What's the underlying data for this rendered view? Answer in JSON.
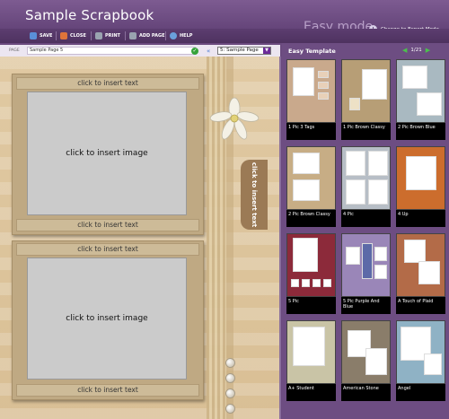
{
  "app": {
    "title": "Sample Scrapbook",
    "mode_label": "Easy mode",
    "expert_link": "Change to Expert Mode"
  },
  "toolbar": {
    "items": [
      {
        "label": "SAVE",
        "icon": "save-icon",
        "color": "#5a8fd8"
      },
      {
        "label": "CLOSE",
        "icon": "close-icon",
        "color": "#e0743a"
      },
      {
        "label": "PRINT",
        "icon": "print-icon",
        "color": "#9aa3b0"
      },
      {
        "label": "ADD PAGE",
        "icon": "add-page-icon",
        "color": "#9aa3b0"
      },
      {
        "label": "HELP",
        "icon": "help-icon",
        "color": "#6aa0dc"
      }
    ]
  },
  "pagebar": {
    "label": "PAGE",
    "value": "Sample Page 5",
    "select_value": "5: Sample Page"
  },
  "canvas": {
    "text_placeholder": "click to insert text",
    "image_placeholder": "click to insert image",
    "side_tab": "click to insert text"
  },
  "templates": {
    "title": "Easy Template",
    "page_counter": "1/21",
    "items": [
      {
        "name": "1 Pic 3 Tags",
        "bg": "#c9a98c"
      },
      {
        "name": "1 Pic Brown Classy",
        "bg": "#b79e76"
      },
      {
        "name": "2 Pic Brown Blue",
        "bg": "#a9b9c1"
      },
      {
        "name": "2 Pic Brown Classy",
        "bg": "#c7ad85"
      },
      {
        "name": "4 Pic",
        "bg": "#b7bec6"
      },
      {
        "name": "4 Up",
        "bg": "#cc6d2d"
      },
      {
        "name": "5 Pic",
        "bg": "#8c2a3a"
      },
      {
        "name": "5 Pic Purple And Blue",
        "bg": "#9a86b8"
      },
      {
        "name": "A Touch of Plaid",
        "bg": "#b36b48"
      },
      {
        "name": "A+ Student",
        "bg": "#c9c4a6"
      },
      {
        "name": "American Stone",
        "bg": "#8a7d6a"
      },
      {
        "name": "Angel",
        "bg": "#8fb2c5"
      }
    ]
  }
}
